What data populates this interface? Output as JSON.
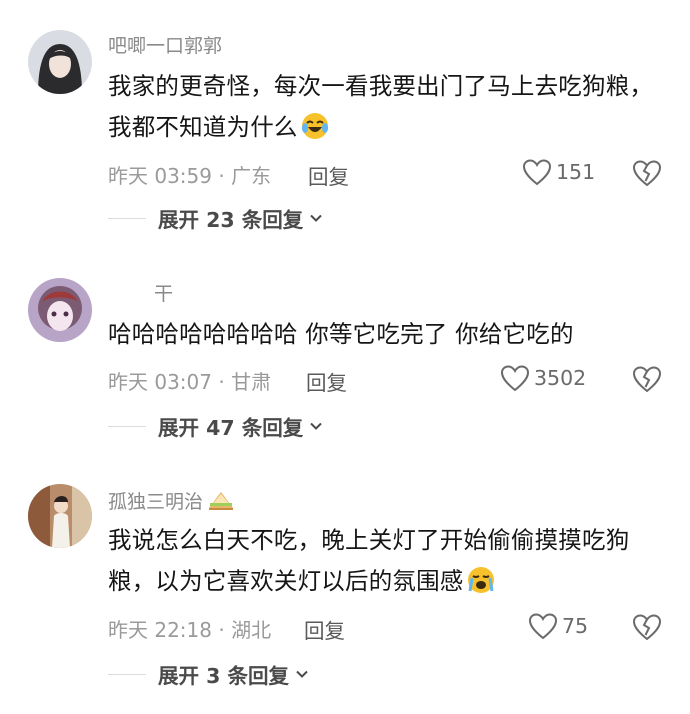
{
  "comments": [
    {
      "username": "吧唧一口郭郭",
      "text": "我家的更奇怪，每次一看我要出门了马上去吃狗粮，我都不知道为什么",
      "text_emoji": "rolling-laugh-emoji",
      "time": "昨天 03:59 · 广东",
      "reply_label": "回复",
      "like_count": "151",
      "expand_label": "展开 23 条回复"
    },
    {
      "username": "干",
      "text": "哈哈哈哈哈哈哈哈 你等它吃完了 你给它吃的",
      "time": "昨天 03:07 · 甘肃",
      "reply_label": "回复",
      "like_count": "3502",
      "expand_label": "展开 47 条回复"
    },
    {
      "username": "孤独三明治",
      "username_emoji": "sandwich-emoji",
      "text": "我说怎么白天不吃，晚上关灯了开始偷偷摸摸吃狗粮，以为它喜欢关灯以后的氛围感",
      "text_emoji": "crying-emoji",
      "time": "昨天 22:18 · 湖北",
      "reply_label": "回复",
      "like_count": "75",
      "expand_label": "展开 3 条回复"
    }
  ],
  "icons": {
    "like": "heart-outline-icon",
    "dislike": "broken-heart-icon",
    "expand": "chevron-down-icon"
  },
  "colors": {
    "text": "#161616",
    "meta": "#9a9a9a",
    "emoji_yellow": "#f7c12c"
  }
}
